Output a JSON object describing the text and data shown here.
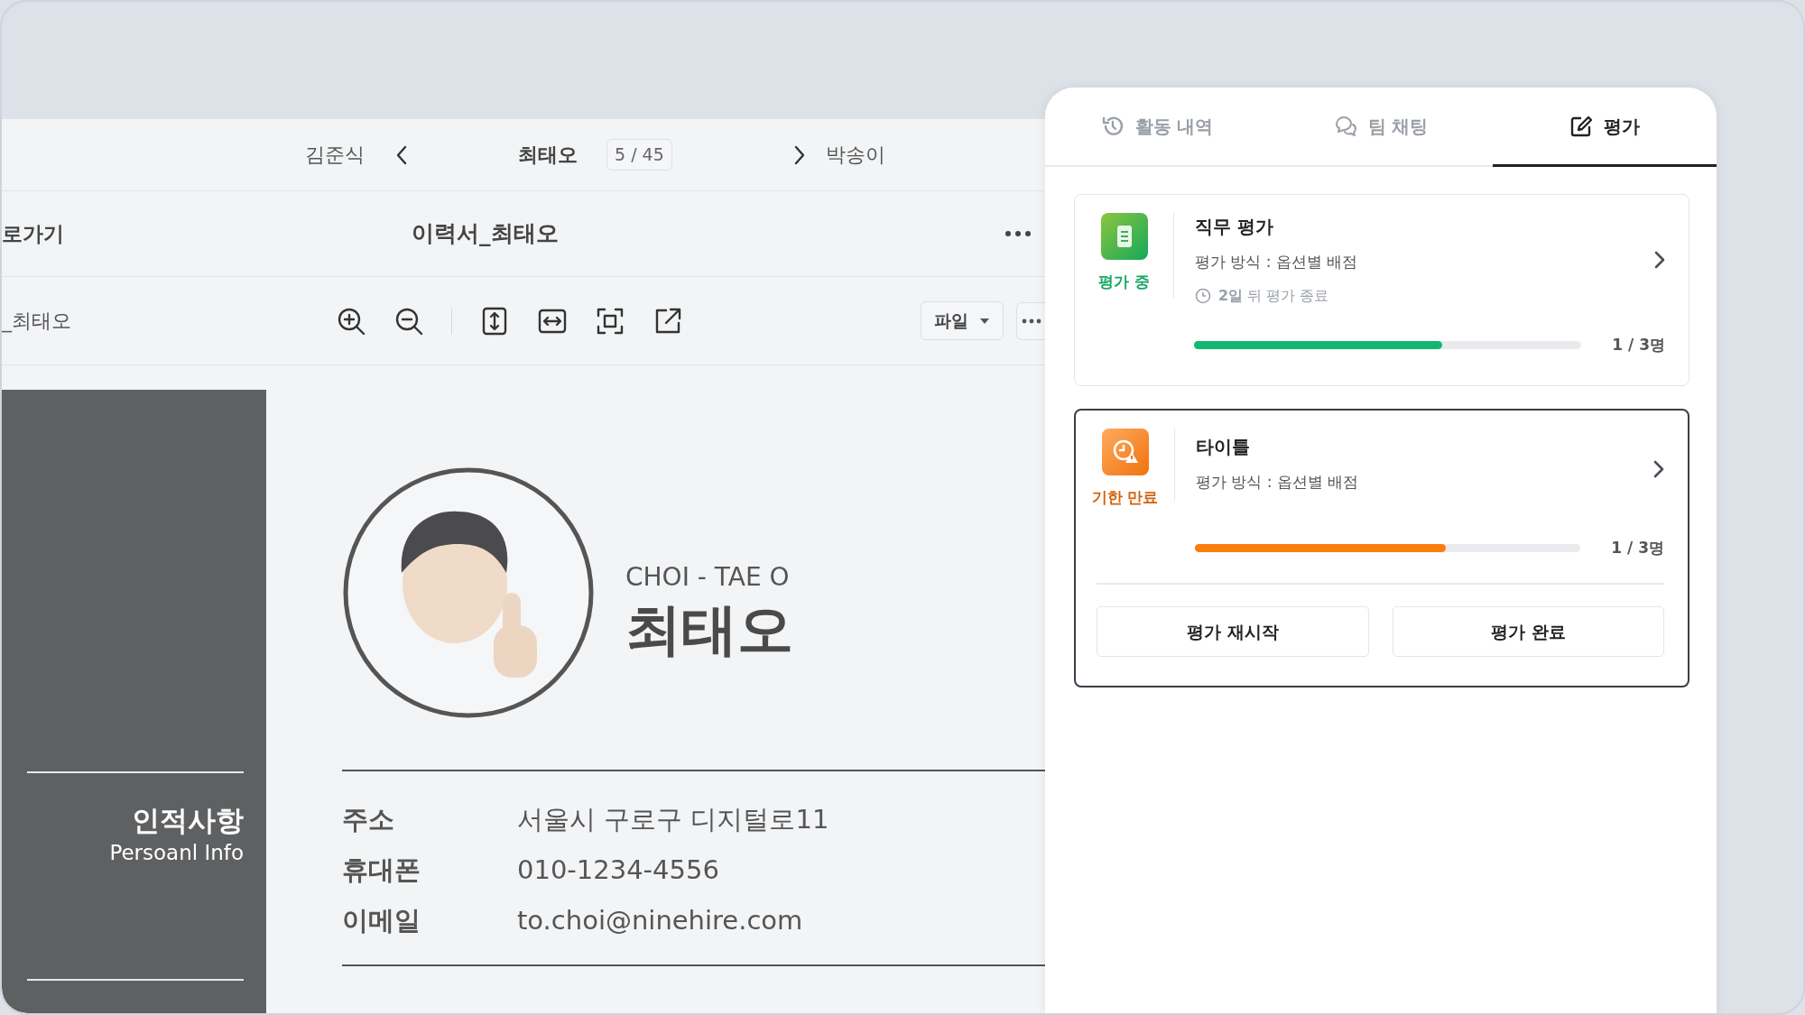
{
  "navigator": {
    "previous": "김준식",
    "current": "최태오",
    "position": "5 / 45",
    "next": "박송이"
  },
  "document_header": {
    "back": "로가기",
    "title": "이력서_최태오"
  },
  "toolbar": {
    "file_name": "_최태오",
    "file_menu": "파일"
  },
  "resume": {
    "english_name": "CHOI - TAE O",
    "name": "최태오",
    "section_title": "인적사항",
    "section_subtitle": "Persoanl Info",
    "fields": [
      {
        "label": "주소",
        "value": "서울시 구로구 디지털로11"
      },
      {
        "label": "휴대폰",
        "value": "010-1234-4556"
      },
      {
        "label": "이메일",
        "value": "to.choi@ninehire.com"
      }
    ]
  },
  "panel": {
    "tabs": [
      {
        "label": "활동 내역",
        "kind": "history",
        "selected": false
      },
      {
        "label": "팀 채팅",
        "kind": "chat",
        "selected": false
      },
      {
        "label": "평가",
        "kind": "edit",
        "selected": true
      }
    ],
    "evaluations": [
      {
        "kind": "in_progress",
        "status": "평가 중",
        "title": "직무 평가",
        "method": "평가 방식 : 옵션별 배점",
        "deadline": "**2일** 뒤 평가 종료",
        "level": 0.64,
        "count": "1 / 3명",
        "selected": false
      },
      {
        "kind": "expired",
        "status": "기한 만료",
        "title": "타이틀",
        "method": "평가 방식 : 옵션별 배점",
        "level": 0.65,
        "count": "1 / 3명",
        "selected": true,
        "actions": [
          "평가 재시작",
          "평가 완료"
        ]
      }
    ]
  }
}
